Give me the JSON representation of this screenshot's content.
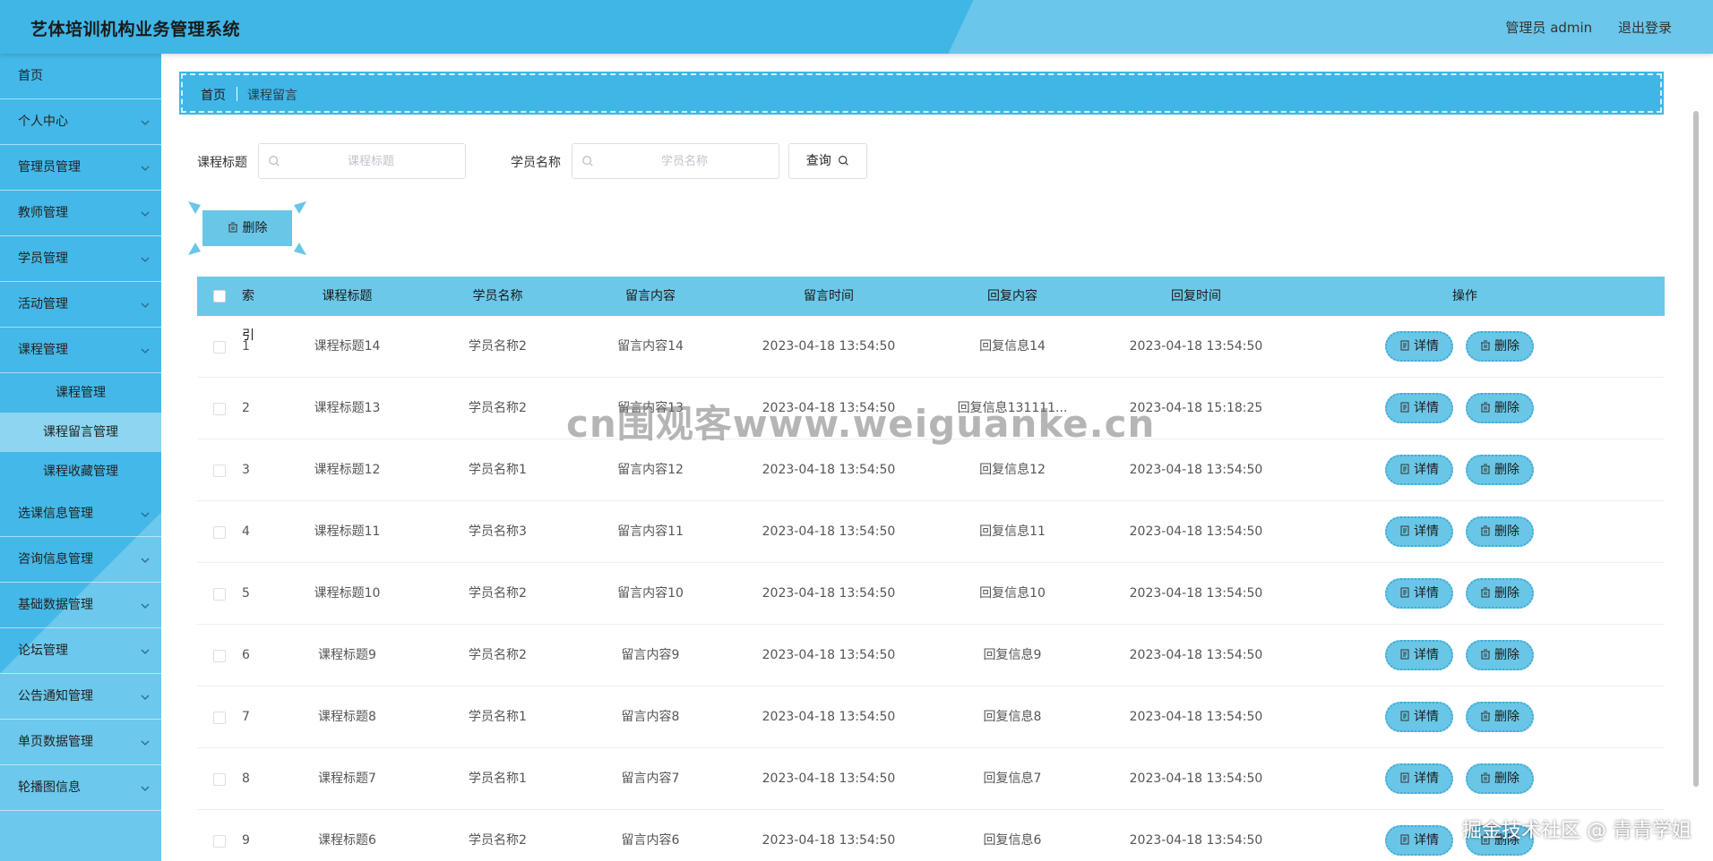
{
  "header": {
    "title": "艺体培训机构业务管理系统",
    "user": "管理员 admin",
    "logout": "退出登录"
  },
  "sidebar": {
    "items": [
      {
        "label": "首页",
        "arrow": false
      },
      {
        "label": "个人中心",
        "arrow": true
      },
      {
        "label": "管理员管理",
        "arrow": true
      },
      {
        "label": "教师管理",
        "arrow": true
      },
      {
        "label": "学员管理",
        "arrow": true
      },
      {
        "label": "活动管理",
        "arrow": true
      },
      {
        "label": "课程管理",
        "arrow": true,
        "expanded": true
      }
    ],
    "sub_items": [
      {
        "label": "课程管理"
      },
      {
        "label": "课程留言管理",
        "active": true
      },
      {
        "label": "课程收藏管理"
      }
    ],
    "items_after": [
      {
        "label": "选课信息管理"
      },
      {
        "label": "咨询信息管理"
      },
      {
        "label": "基础数据管理"
      },
      {
        "label": "论坛管理"
      },
      {
        "label": "公告通知管理"
      },
      {
        "label": "单页数据管理"
      },
      {
        "label": "轮播图信息"
      }
    ]
  },
  "breadcrumb": {
    "home": "首页",
    "current": "课程留言"
  },
  "search": {
    "title_label": "课程标题",
    "title_placeholder": "课程标题",
    "student_label": "学员名称",
    "student_placeholder": "学员名称",
    "query_label": "查询"
  },
  "batch_delete_label": "删除",
  "table": {
    "headers": [
      "索引",
      "课程标题",
      "学员名称",
      "留言内容",
      "留言时间",
      "回复内容",
      "回复时间",
      "操作"
    ],
    "detail_label": "详情",
    "delete_label": "删除",
    "rows": [
      {
        "index": "1",
        "title": "课程标题14",
        "student": "学员名称2",
        "content": "留言内容14",
        "time": "2023-04-18 13:54:50",
        "reply": "回复信息14",
        "reply_time": "2023-04-18 13:54:50"
      },
      {
        "index": "2",
        "title": "课程标题13",
        "student": "学员名称2",
        "content": "留言内容13",
        "time": "2023-04-18 13:54:50",
        "reply": "回复信息131111...",
        "reply_time": "2023-04-18 15:18:25"
      },
      {
        "index": "3",
        "title": "课程标题12",
        "student": "学员名称1",
        "content": "留言内容12",
        "time": "2023-04-18 13:54:50",
        "reply": "回复信息12",
        "reply_time": "2023-04-18 13:54:50"
      },
      {
        "index": "4",
        "title": "课程标题11",
        "student": "学员名称3",
        "content": "留言内容11",
        "time": "2023-04-18 13:54:50",
        "reply": "回复信息11",
        "reply_time": "2023-04-18 13:54:50"
      },
      {
        "index": "5",
        "title": "课程标题10",
        "student": "学员名称2",
        "content": "留言内容10",
        "time": "2023-04-18 13:54:50",
        "reply": "回复信息10",
        "reply_time": "2023-04-18 13:54:50"
      },
      {
        "index": "6",
        "title": "课程标题9",
        "student": "学员名称2",
        "content": "留言内容9",
        "time": "2023-04-18 13:54:50",
        "reply": "回复信息9",
        "reply_time": "2023-04-18 13:54:50"
      },
      {
        "index": "7",
        "title": "课程标题8",
        "student": "学员名称1",
        "content": "留言内容8",
        "time": "2023-04-18 13:54:50",
        "reply": "回复信息8",
        "reply_time": "2023-04-18 13:54:50"
      },
      {
        "index": "8",
        "title": "课程标题7",
        "student": "学员名称1",
        "content": "留言内容7",
        "time": "2023-04-18 13:54:50",
        "reply": "回复信息7",
        "reply_time": "2023-04-18 13:54:50"
      },
      {
        "index": "9",
        "title": "课程标题6",
        "student": "学员名称2",
        "content": "留言内容6",
        "time": "2023-04-18 13:54:50",
        "reply": "回复信息6",
        "reply_time": "2023-04-18 13:54:50"
      }
    ]
  },
  "watermark": "cn围观客www.weiguanke.cn",
  "corner_watermark": "掘金技术社区 @ 青青学姐",
  "colors": {
    "primary": "#3fb6e6",
    "button": "#6ac6e6",
    "active_sub": "#8dd5f0"
  }
}
